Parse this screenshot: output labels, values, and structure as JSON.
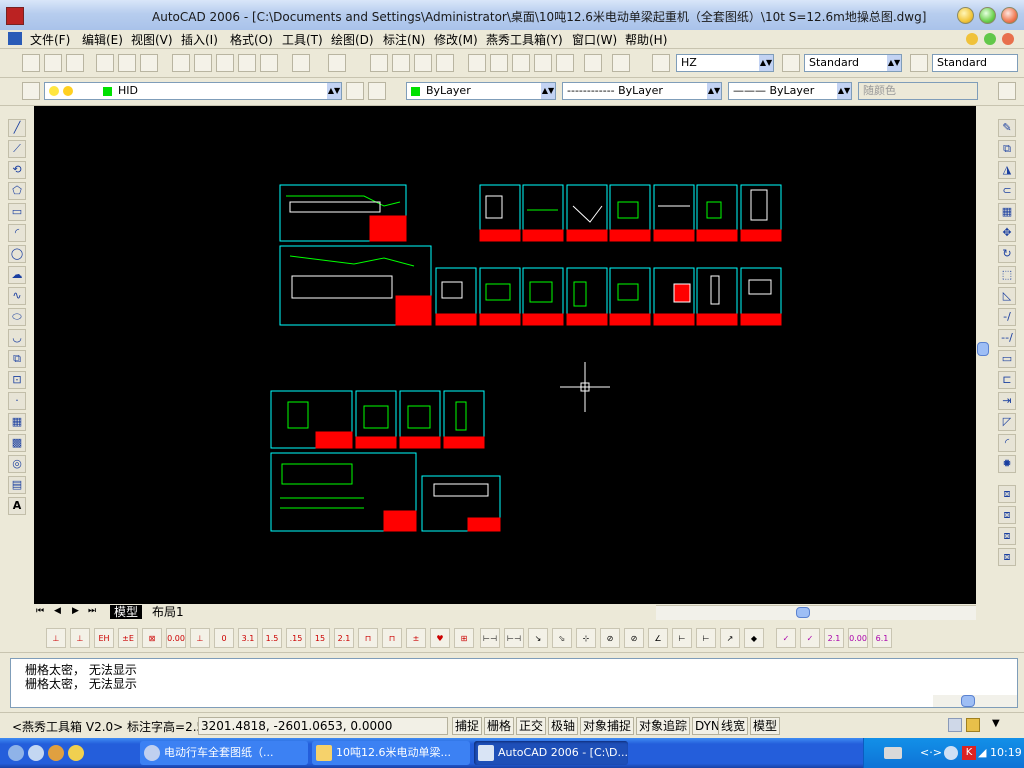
{
  "window": {
    "title": "AutoCAD 2006 - [C:\\Documents and Settings\\Administrator\\桌面\\10吨12.6米电动单梁起重机（全套图纸）\\10t S=12.6m地操总图.dwg]"
  },
  "menu": [
    "文件(F)",
    "编辑(E)",
    "视图(V)",
    "插入(I)",
    "格式(O)",
    "工具(T)",
    "绘图(D)",
    "标注(N)",
    "修改(M)",
    "燕秀工具箱(Y)",
    "窗口(W)",
    "帮助(H)"
  ],
  "styles": {
    "text_style": "HZ",
    "dim_style": "Standard",
    "table_style": "Standard"
  },
  "layers": {
    "current": "HID",
    "color": "ByLayer",
    "linetype": "------------ ByLayer",
    "lineweight": "——— ByLayer",
    "plotstyle": "随颜色"
  },
  "tabs": {
    "model": "模型",
    "layout": "布局1"
  },
  "command": {
    "lines": [
      "栅格太密， 无法显示",
      "栅格太密， 无法显示"
    ]
  },
  "status": {
    "toolbox": "<燕秀工具箱 V2.0> 标注字高=2.5",
    "coords": "3201.4818, -2601.0653, 0.0000",
    "toggles": [
      "捕捉",
      "栅格",
      "正交",
      "极轴",
      "对象捕捉",
      "对象追踪",
      "DYN",
      "线宽",
      "模型"
    ]
  },
  "taskbar": {
    "items": [
      "电动行车全套图纸（...",
      "10吨12.6米电动单梁...",
      "AutoCAD 2006 - [C:\\D..."
    ],
    "clock": "10:19"
  },
  "colors": {
    "canvas": "#000000",
    "frame": "#00ffff",
    "title_block": "#ff0000",
    "xp_blue": "#245edb"
  }
}
